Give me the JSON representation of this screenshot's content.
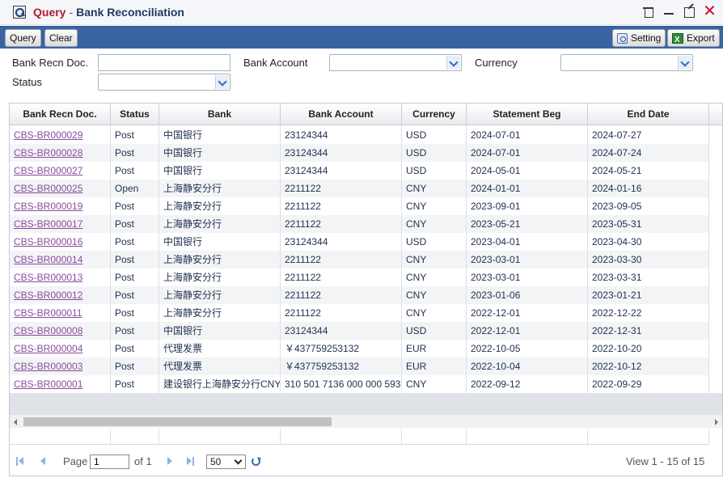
{
  "window": {
    "title_prefix": "Query",
    "title_sep": "-",
    "title_main": "Bank Reconciliation"
  },
  "toolbar": {
    "query_label": "Query",
    "clear_label": "Clear",
    "setting_label": "Setting",
    "export_label": "Export"
  },
  "filters": {
    "bank_recn_doc_label": "Bank Recn Doc.",
    "bank_recn_doc_value": "",
    "bank_account_label": "Bank Account",
    "bank_account_value": "",
    "currency_label": "Currency",
    "currency_value": "",
    "status_label": "Status",
    "status_value": ""
  },
  "grid": {
    "columns": [
      "Bank Recn Doc.",
      "Status",
      "Bank",
      "Bank Account",
      "Currency",
      "Statement Beg",
      "End Date"
    ],
    "rows": [
      [
        "CBS-BR000029",
        "Post",
        "中国银行",
        "23124344",
        "USD",
        "2024-07-01",
        "2024-07-27"
      ],
      [
        "CBS-BR000028",
        "Post",
        "中国银行",
        "23124344",
        "USD",
        "2024-07-01",
        "2024-07-24"
      ],
      [
        "CBS-BR000027",
        "Post",
        "中国银行",
        "23124344",
        "USD",
        "2024-05-01",
        "2024-05-21"
      ],
      [
        "CBS-BR000025",
        "Open",
        "上海静安分行",
        "2211122",
        "CNY",
        "2024-01-01",
        "2024-01-16"
      ],
      [
        "CBS-BR000019",
        "Post",
        "上海静安分行",
        "2211122",
        "CNY",
        "2023-09-01",
        "2023-09-05"
      ],
      [
        "CBS-BR000017",
        "Post",
        "上海静安分行",
        "2211122",
        "CNY",
        "2023-05-21",
        "2023-05-31"
      ],
      [
        "CBS-BR000016",
        "Post",
        "中国银行",
        "23124344",
        "USD",
        "2023-04-01",
        "2023-04-30"
      ],
      [
        "CBS-BR000014",
        "Post",
        "上海静安分行",
        "2211122",
        "CNY",
        "2023-03-01",
        "2023-03-30"
      ],
      [
        "CBS-BR000013",
        "Post",
        "上海静安分行",
        "2211122",
        "CNY",
        "2023-03-01",
        "2023-03-31"
      ],
      [
        "CBS-BR000012",
        "Post",
        "上海静安分行",
        "2211122",
        "CNY",
        "2023-01-06",
        "2023-01-21"
      ],
      [
        "CBS-BR000011",
        "Post",
        "上海静安分行",
        "2211122",
        "CNY",
        "2022-12-01",
        "2022-12-22"
      ],
      [
        "CBS-BR000008",
        "Post",
        "中国银行",
        "23124344",
        "USD",
        "2022-12-01",
        "2022-12-31"
      ],
      [
        "CBS-BR000004",
        "Post",
        "代理发票",
        "￥437759253132",
        "EUR",
        "2022-10-05",
        "2022-10-20"
      ],
      [
        "CBS-BR000003",
        "Post",
        "代理发票",
        "￥437759253132",
        "EUR",
        "2022-10-04",
        "2022-10-12"
      ],
      [
        "CBS-BR000001",
        "Post",
        "建设银行上海静安分行CNY",
        "310 501 7136 000 000 593",
        "CNY",
        "2022-09-12",
        "2022-09-29"
      ]
    ]
  },
  "pager": {
    "page_label": "Page",
    "page_value": "1",
    "of_label": "of 1",
    "page_size": "50",
    "view_text": "View 1 - 15 of 15"
  },
  "colors": {
    "toolbar_bg": "#3a63a3",
    "title_accent": "#b01c2e",
    "link_color": "#8a4b9d"
  }
}
